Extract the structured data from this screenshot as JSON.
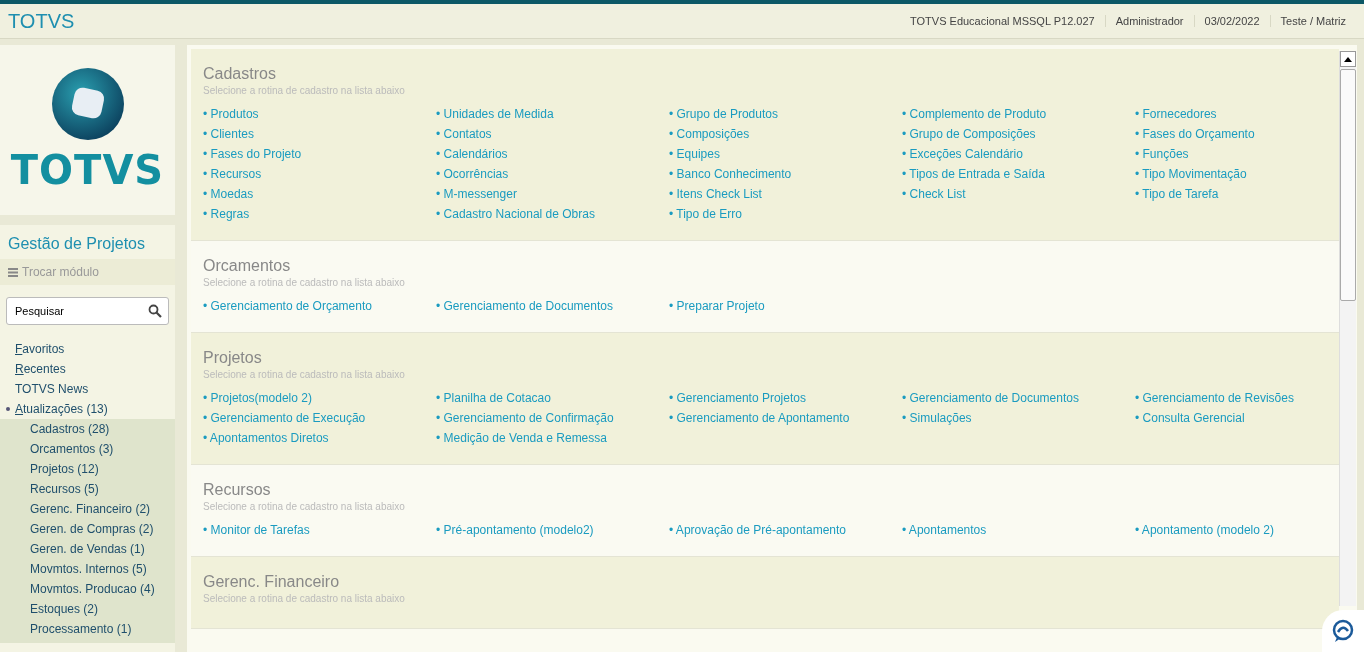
{
  "topbar": {
    "brand": "TOTVS",
    "info": [
      "TOTVS Educacional MSSQL P12.027",
      "Administrador",
      "03/02/2022",
      "Teste / Matriz"
    ]
  },
  "sidebar": {
    "logo_text": "TOTVS",
    "module_title": "Gestão de Projetos",
    "switch_module": "Trocar módulo",
    "search": {
      "placeholder": "Pesquisar"
    },
    "menu": [
      {
        "label": "Favoritos",
        "underline_first": true,
        "expanded": false
      },
      {
        "label": "Recentes",
        "underline_first": true,
        "expanded": false
      },
      {
        "label": "TOTVS News",
        "underline_first": false,
        "expanded": false
      },
      {
        "label": "Atualizações (13)",
        "underline_first": true,
        "expanded": true,
        "children": [
          {
            "label": "Cadastros (28)"
          },
          {
            "label": "Orcamentos (3)"
          },
          {
            "label": "Projetos (12)"
          },
          {
            "label": "Recursos (5)"
          },
          {
            "label": "Gerenc. Financeiro (2)"
          },
          {
            "label": "Geren. de Compras (2)"
          },
          {
            "label": "Geren. de Vendas (1)"
          },
          {
            "label": "Movmtos. Internos (5)"
          },
          {
            "label": "Movmtos. Producao (4)"
          },
          {
            "label": "Estoques (2)"
          },
          {
            "label": "Processamento (1)"
          }
        ]
      }
    ]
  },
  "sections": [
    {
      "title": "Cadastros",
      "subtitle": "Selecione a rotina de cadastro na lista abaixo",
      "links": [
        "• Produtos",
        "• Unidades de Medida",
        "• Grupo de Produtos",
        "• Complemento de Produto",
        "• Fornecedores",
        "• Clientes",
        "• Contatos",
        "• Composições",
        "• Grupo de Composições",
        "• Fases do Orçamento",
        "• Fases do Projeto",
        "• Calendários",
        "• Equipes",
        "• Exceções Calendário",
        "• Funções",
        "• Recursos",
        "• Ocorrências",
        "• Banco Conhecimento",
        "• Tipos de Entrada e Saída",
        "• Tipo Movimentação",
        "• Moedas",
        "• M-messenger",
        "• Itens Check List",
        "• Check  List",
        "• Tipo de Tarefa",
        "• Regras",
        "• Cadastro Nacional de Obras",
        "• Tipo de Erro"
      ]
    },
    {
      "title": "Orcamentos",
      "subtitle": "Selecione a rotina de cadastro na lista abaixo",
      "links": [
        "• Gerenciamento de Orçamento",
        "• Gerenciamento de Documentos",
        "• Preparar Projeto"
      ]
    },
    {
      "title": "Projetos",
      "subtitle": "Selecione a rotina de cadastro na lista abaixo",
      "links": [
        "• Projetos(modelo 2)",
        "• Planilha de Cotacao",
        "• Gerenciamento Projetos",
        "• Gerenciamento de Documentos",
        "• Gerenciamento de Revisões",
        "• Gerenciamento de Execução",
        "• Gerenciamento de Confirmação",
        "• Gerenciamento de Apontamento",
        "• Simulações",
        "• Consulta Gerencial",
        "• Apontamentos Diretos",
        "• Medição de Venda e Remessa"
      ]
    },
    {
      "title": "Recursos",
      "subtitle": "Selecione a rotina de cadastro na lista abaixo",
      "links": [
        "• Monitor de Tarefas",
        "• Pré-apontamento (modelo2)",
        "• Aprovação de Pré-apontamento",
        "• Apontamentos",
        "• Apontamento (modelo 2)"
      ]
    },
    {
      "title": "Gerenc. Financeiro",
      "subtitle": "Selecione a rotina de cadastro na lista abaixo"
    }
  ]
}
